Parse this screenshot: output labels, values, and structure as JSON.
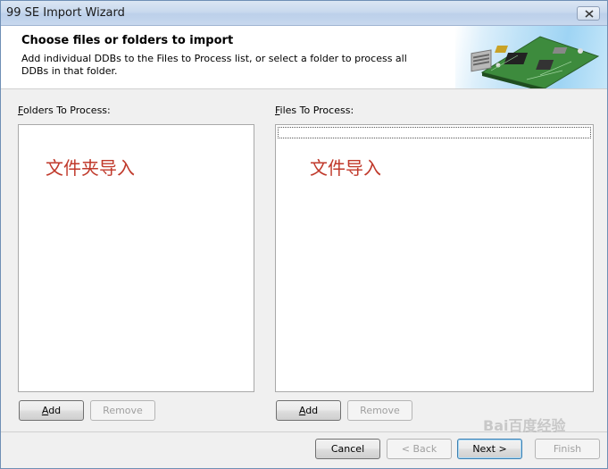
{
  "window": {
    "title": "99 SE Import Wizard"
  },
  "header": {
    "title": "Choose files or folders to import",
    "description": "Add individual DDBs to the Files to Process list, or select a folder to process all DDBs in that folder."
  },
  "folders_panel": {
    "label_hotkey": "F",
    "label_rest": "olders To Process:",
    "overlay_text": "文件夹导入",
    "add_hotkey": "A",
    "add_rest": "dd",
    "remove_label": "Remove"
  },
  "files_panel": {
    "label_hotkey": "F",
    "label_rest": "iles To Process:",
    "overlay_text": "文件导入",
    "add_hotkey": "A",
    "add_rest": "dd",
    "remove_label": "Remove"
  },
  "footer": {
    "cancel_label": "Cancel",
    "back_label": "< Back",
    "next_label": "Next >",
    "finish_label": "Finish"
  },
  "watermark": {
    "text": "Bai百度经验"
  },
  "colors": {
    "accent": "#3c7fb1",
    "annotation_text": "#c0392b"
  },
  "icons": {
    "close": "close-icon",
    "header_art": "circuit-board-illustration"
  }
}
